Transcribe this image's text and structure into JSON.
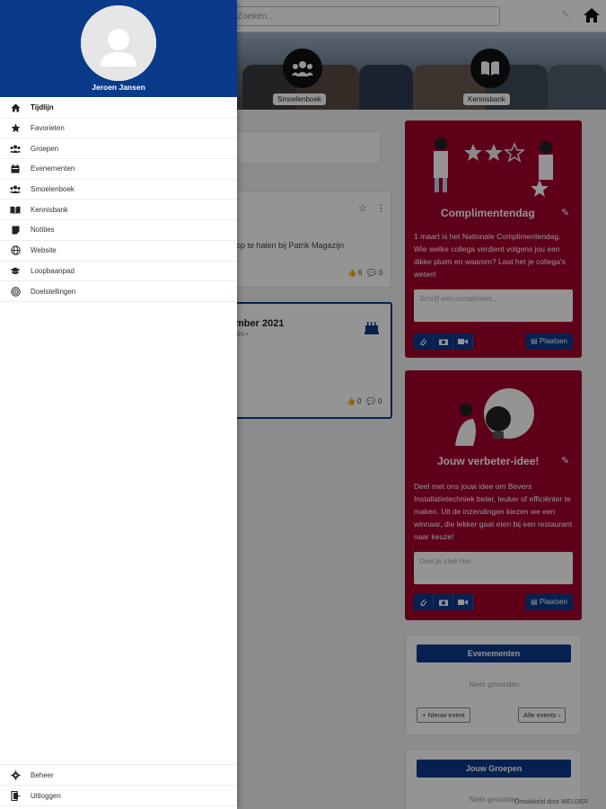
{
  "topbar": {
    "search_placeholder": "Zoeken...",
    "icons": [
      "pencil-icon",
      "home-icon"
    ]
  },
  "banner": {
    "smoelenboek_label": "Smoelenboek",
    "kennisbank_label": "Kennisbank"
  },
  "feed": {
    "post_snippet": "op te halen bij Patrik Magazijn",
    "post1_likes": "6",
    "post1_comments": "0",
    "event_title": "mber 2021",
    "event_sub": "tilis •",
    "post2_likes": "0",
    "post2_comments": "0"
  },
  "compliment": {
    "title": "Complimentendag",
    "body": "1 maart is het Nationale Complimentendag. Wie welke collega verdient volgens jou een dikke pluim en waarom? Laat het je collega's weten!",
    "input_placeholder": "Schrijf een compliment...",
    "post_label": "Plaatsen"
  },
  "idea": {
    "title": "Jouw verbeter-idee!",
    "body": "Deel met ons jouw idee om Bevers Installatietechniek beter, leuker of efficiënter te maken. Uit de inzendingen kiezen we een winnaar, die lekker gaat eten bij een restaurant naar keuze!",
    "input_placeholder": "Deel je idee hier...",
    "post_label": "Plaatsen"
  },
  "events": {
    "header": "Evenementen",
    "empty_text": "Niets gevonden",
    "new_label": "Nieuw event",
    "all_label": "Alle events"
  },
  "groups": {
    "header": "Jouw Groepen",
    "empty_text": "Niets gevonden"
  },
  "watermark": "Ontwikkeld door WELDER",
  "drawer": {
    "user_name": "Jeroen Jansen",
    "items": [
      {
        "label": "Tijdlijn",
        "icon": "home-icon",
        "active": true
      },
      {
        "label": "Favorieten",
        "icon": "star-icon",
        "active": false
      },
      {
        "label": "Groepen",
        "icon": "users-icon",
        "active": false
      },
      {
        "label": "Evenementen",
        "icon": "calendar-icon",
        "active": false
      },
      {
        "label": "Smoelenboek",
        "icon": "users-icon",
        "active": false
      },
      {
        "label": "Kennisbank",
        "icon": "book-icon",
        "active": false
      },
      {
        "label": "Notities",
        "icon": "note-icon",
        "active": false
      },
      {
        "label": "Website",
        "icon": "globe-icon",
        "active": false
      },
      {
        "label": "Loopbaanpad",
        "icon": "graduation-icon",
        "active": false
      },
      {
        "label": "Doelstellingen",
        "icon": "target-icon",
        "active": false
      }
    ],
    "bottom_items": [
      {
        "label": "Beheer",
        "icon": "gear-icon"
      },
      {
        "label": "Uitloggen",
        "icon": "logout-icon"
      }
    ]
  },
  "colors": {
    "primary_blue": "#0b3a8a",
    "card_red": "#a3002a"
  }
}
